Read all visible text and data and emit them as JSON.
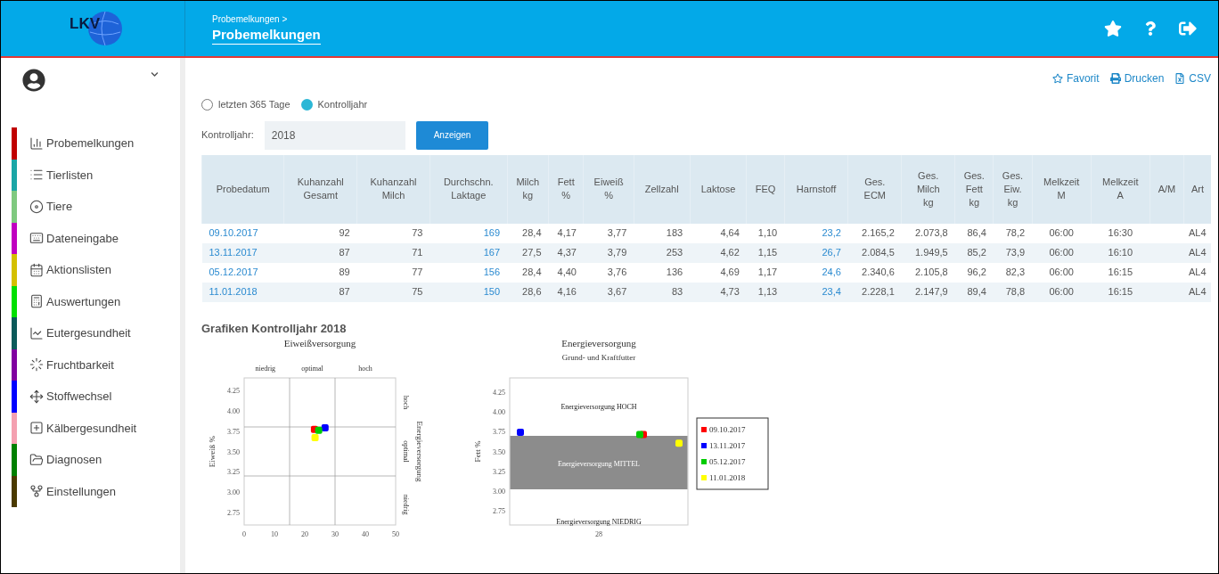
{
  "header": {
    "breadcrumb": "Probemelkungen >",
    "title": "Probemelkungen"
  },
  "logo": {
    "text": "LKV"
  },
  "actions": [
    {
      "kind": "favorite",
      "label": "Favorit"
    },
    {
      "kind": "print",
      "label": "Drucken"
    },
    {
      "kind": "csv",
      "label": "CSV"
    }
  ],
  "sidebar": {
    "items": [
      {
        "kind": "chart",
        "label": "Probemelkungen",
        "color": "#c00000"
      },
      {
        "kind": "list",
        "label": "Tierlisten",
        "color": "#1aa6a6"
      },
      {
        "kind": "disc",
        "label": "Tiere",
        "color": "#7fc97f"
      },
      {
        "kind": "keyboard",
        "label": "Dateneingabe",
        "color": "#c000c0"
      },
      {
        "kind": "calendar",
        "label": "Aktionslisten",
        "color": "#d4c000"
      },
      {
        "kind": "calculator",
        "label": "Auswertungen",
        "color": "#00e000"
      },
      {
        "kind": "line",
        "label": "Eutergesundheit",
        "color": "#0a5a5a"
      },
      {
        "kind": "spinner",
        "label": "Fruchtbarkeit",
        "color": "#8000a0"
      },
      {
        "kind": "move",
        "label": "Stoffwechsel",
        "color": "#0000ff"
      },
      {
        "kind": "plus",
        "label": "Kälbergesundheit",
        "color": "#f4a0b0"
      },
      {
        "kind": "folder",
        "label": "Diagnosen",
        "color": "#008000"
      },
      {
        "kind": "fork",
        "label": "Einstellungen",
        "color": "#4a3a00"
      }
    ]
  },
  "period": [
    {
      "label": "letzten 365 Tage",
      "selected": false
    },
    {
      "label": "Kontrolljahr",
      "selected": true
    }
  ],
  "year_field": {
    "label": "Kontrolljahr:",
    "value": "2018"
  },
  "show_button": "Anzeigen",
  "table": {
    "columns": [
      {
        "label": "Probedatum",
        "kind": "link"
      },
      {
        "label": "Kuhanzahl\nGesamt",
        "kind": "number"
      },
      {
        "label": "Kuhanzahl\nMilch",
        "kind": "number"
      },
      {
        "label": "Durchschn.\nLaktage",
        "kind": "link-number"
      },
      {
        "label": "Milch\nkg",
        "kind": "number"
      },
      {
        "label": "Fett\n%",
        "kind": "number"
      },
      {
        "label": "Eiweiß\n%",
        "kind": "number"
      },
      {
        "label": "Zellzahl",
        "kind": "number"
      },
      {
        "label": "Laktose",
        "kind": "number"
      },
      {
        "label": "FEQ",
        "kind": "number"
      },
      {
        "label": "Harnstoff",
        "kind": "link-number"
      },
      {
        "label": "Ges.\nECM",
        "kind": "number"
      },
      {
        "label": "Ges.\nMilch\nkg",
        "kind": "number"
      },
      {
        "label": "Ges.\nFett\nkg",
        "kind": "number"
      },
      {
        "label": "Ges.\nEiw.\nkg",
        "kind": "number"
      },
      {
        "label": "Melkzeit\nM",
        "kind": "center"
      },
      {
        "label": "Melkzeit\nA",
        "kind": "center"
      },
      {
        "label": "A/M",
        "kind": "center"
      },
      {
        "label": "Art",
        "kind": "center"
      }
    ],
    "rows": [
      [
        "09.10.2017",
        "92",
        "73",
        "169",
        "28,4",
        "4,17",
        "3,77",
        "183",
        "4,64",
        "1,10",
        "23,2",
        "2.165,2",
        "2.073,8",
        "86,4",
        "78,2",
        "06:00",
        "16:30",
        null,
        "AL4"
      ],
      [
        "13.11.2017",
        "87",
        "71",
        "167",
        "27,5",
        "4,37",
        "3,79",
        "253",
        "4,62",
        "1,15",
        "26,7",
        "2.084,5",
        "1.949,5",
        "85,2",
        "73,9",
        "06:00",
        "16:10",
        null,
        "AL4"
      ],
      [
        "05.12.2017",
        "89",
        "77",
        "156",
        "28,4",
        "4,40",
        "3,76",
        "136",
        "4,69",
        "1,17",
        "24,6",
        "2.340,6",
        "2.105,8",
        "96,2",
        "82,3",
        "06:00",
        "16:15",
        null,
        "AL4"
      ],
      [
        "11.01.2018",
        "87",
        "75",
        "150",
        "28,6",
        "4,16",
        "3,67",
        "83",
        "4,73",
        "1,13",
        "23,4",
        "2.228,1",
        "2.147,9",
        "89,4",
        "78,8",
        "06:00",
        "16:15",
        null,
        "AL4"
      ]
    ]
  },
  "charts_title": "Grafiken Kontrolljahr 2018",
  "charts": [
    {
      "kind": "quadrant",
      "top_labels": [
        "niedrig",
        "optimal",
        "hoch"
      ],
      "right_labels": [
        "hoch",
        "optimal",
        "niedrig"
      ],
      "right_title": "Energieversorgung",
      "chart_data": {
        "type": "scatter",
        "title": "Eiweißversorgung",
        "ylabel": "Eiweiß %",
        "x": [
          23.2,
          26.7,
          24.6,
          23.4
        ],
        "xlim": [
          0,
          50
        ],
        "ylim": [
          2.6,
          4.4
        ],
        "xticks": [
          0,
          10,
          20,
          30,
          40,
          50
        ],
        "yticks": [
          {
            "value": 4.25,
            "label": "4.25"
          },
          {
            "value": 4.0,
            "label": "4.00"
          },
          {
            "value": 3.75,
            "label": "3.75"
          },
          {
            "value": 3.5,
            "label": "3.50"
          },
          {
            "value": 3.25,
            "label": "3.25"
          },
          {
            "value": 3.0,
            "label": "3.00"
          },
          {
            "value": 2.75,
            "label": "2.75"
          }
        ],
        "series": [
          {
            "color": "#ff0000",
            "values": [
              3.77,
              null,
              null,
              null
            ]
          },
          {
            "color": "#0000ff",
            "values": [
              null,
              3.79,
              null,
              null
            ]
          },
          {
            "color": "#00cc00",
            "values": [
              null,
              null,
              3.76,
              null
            ]
          },
          {
            "color": "#ffff00",
            "values": [
              null,
              null,
              null,
              3.67
            ]
          }
        ]
      }
    },
    {
      "kind": "zones",
      "title": "Energieversorgung",
      "subtitle": "Grund- und Kraftfutter",
      "ylabel": "Fett %",
      "yticks": [
        "4.25",
        "4.00",
        "3.75",
        "3.50",
        "3.25",
        "3.00",
        "2.75"
      ],
      "xtick": "28",
      "zone_labels": [
        "Energieversorgung HOCH",
        "Energieversorgung MITTEL",
        "Energieversorgung NIEDRIG"
      ],
      "legend": [
        {
          "name": "09.10.2017",
          "color": "#ff0000"
        },
        {
          "name": "13.11.2017",
          "color": "#0000ff"
        },
        {
          "name": "05.12.2017",
          "color": "#00cc00"
        },
        {
          "name": "11.01.2018",
          "color": "#ffff00"
        }
      ]
    }
  ]
}
